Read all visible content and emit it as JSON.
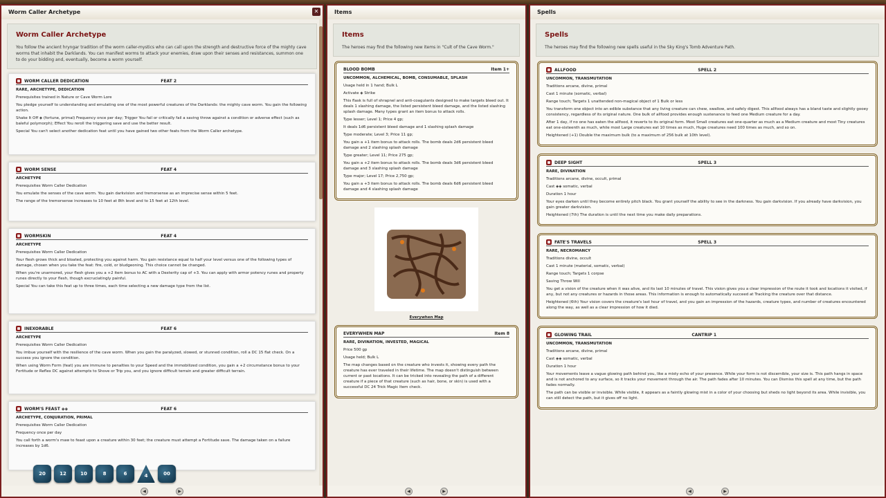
{
  "windows": {
    "worm": {
      "title": "Worm Caller Archetype",
      "header": {
        "title": "Worm Caller Archetype",
        "text": "You follow the ancient hryngar tradition of the worm caller-mystics who can call upon the strength and destructive force of the mighty cave worms that inhabit the Darklands. You can manifest worms to attack your enemies, draw upon their senses and resistances, summon one to do your bidding and, eventually, become a worm yourself."
      },
      "cards": [
        {
          "name": "WORM CALLER DEDICATION",
          "level": "FEAT 2",
          "traits": "RARE, ARCHETYPE, DEDICATION",
          "lines": [
            "Prerequisites trained in Nature or Cave Worm Lore",
            "You pledge yourself to understanding and emulating one of the most powerful creatures of the Darklands: the mighty cave worm. You gain the following action.",
            "Shake It Off ◈ (fortune, primal) Frequency once per day; Trigger You fail or critically fail a saving throw against a condition or adverse effect (such as baleful polymorph); Effect You reroll the triggering save and use the better result.",
            "Special You can't select another dedication feat until you have gained two other feats from the Worm Caller archetype."
          ]
        },
        {
          "name": "WORM SENSE",
          "level": "FEAT 4",
          "traits": "ARCHETYPE",
          "lines": [
            "Prerequisites Worm Caller Dedication",
            "You emulate the senses of the cave worm. You gain darkvision and tremorsense as an imprecise sense within 5 feet.",
            "The range of the tremorsense increases to 10 feet at 8th level and to 15 feet at 12th level."
          ]
        },
        {
          "name": "WORMSKIN",
          "level": "FEAT 4",
          "traits": "ARCHETYPE",
          "lines": [
            "Prerequisites Worm Caller Dedication",
            "Your flesh grows thick and bloated, protecting you against harm. You gain resistance equal to half your level versus one of the following types of damage, chosen when you take the feat: fire, cold, or bludgeoning. This choice cannot be changed.",
            "When you're unarmored, your flesh gives you a +2 item bonus to AC with a Dexterity cap of +3. You can apply with armor potency runes and property runes directly to your flesh, though excruciatingly painful.",
            "Special You can take this feat up to three times, each time selecting a new damage type from the list."
          ]
        },
        {
          "name": "INEXORABLE",
          "level": "FEAT 6",
          "traits": "ARCHETYPE",
          "lines": [
            "Prerequisites Worm Caller Dedication",
            "You imbue yourself with the resilience of the cave worm. When you gain the paralyzed, slowed, or stunned condition, roll a DC 15 flat check. On a success you ignore the condition.",
            "When using Worm Form (feat) you are immune to penalties to your Speed and the immobilized condition, you gain a +2 circumstance bonus to your Fortitude or Reflex DC against attempts to Shove or Trip you, and you ignore difficult terrain and greater difficult terrain."
          ]
        },
        {
          "name": "WORM'S FEAST ◈◈",
          "level": "FEAT 6",
          "traits": "ARCHETYPE, CONJURATION, PRIMAL",
          "lines": [
            "Prerequisites Worm Caller Dedication",
            "Frequency once per day",
            "You call forth a worm's maw to feast upon a creature within 30 feet; the creature must attempt a Fortitude save. The damage taken on a failure increases by 1d6."
          ]
        }
      ],
      "dice": [
        "20",
        "12",
        "10",
        "8",
        "6",
        "4",
        "00"
      ]
    },
    "items": {
      "title": "Items",
      "header": {
        "title": "Items",
        "text": "The heroes may find the following new items in \"Cult of the Cave Worm.\""
      },
      "cards": [
        {
          "name": "BLOOD BOMB",
          "level": "Item 1+",
          "traits": "UNCOMMON, ALCHEMICAL, BOMB, CONSUMABLE, SPLASH",
          "lines": [
            "Usage held in 1 hand; Bulk L",
            "Activate ◈ Strike",
            "This flask is full of shrapnel and anti-coagulants designed to make targets bleed out. It deals 1 slashing damage, the listed persistent bleed damage, and the listed slashing splash damage. Many types grant an item bonus to attack rolls.",
            "Type lesser; Level 1; Price 4 gp;",
            "It deals 1d6 persistent bleed damage and 1 slashing splash damage",
            "Type moderate; Level 3; Price 11 gp;",
            "You gain a +1 item bonus to attack rolls. The bomb deals 2d6 persistent bleed damage and 2 slashing splash damage",
            "Type greater; Level 11; Price 275 gp;",
            "You gain a +2 item bonus to attack rolls. The bomb deals 3d6 persistent bleed damage and 3 slashing splash damage",
            "Type major; Level 17; Price 2,750 gp;",
            "You gain a +3 item bonus to attack rolls. The bomb deals 6d6 persistent bleed damage and 4 slashing splash damage"
          ]
        },
        {
          "name": "EVERYWHEN MAP",
          "level": "Item 8",
          "traits": "RARE, DIVINATION, INVESTED, MAGICAL",
          "lines": [
            "Price 500 gp",
            "Usage held; Bulk L",
            "The map changes based on the creature who invests it, showing every path the creature has ever traveled in their lifetime. The map doesn't distinguish between current or past locations. It can be tricked into revealing the path of a different creature if a piece of that creature (such as hair, bone, or skin) is used with a successful DC 24 Trick Magic Item check."
          ]
        }
      ],
      "map_caption": "Everywhen Map"
    },
    "spells": {
      "title": "Spells",
      "header": {
        "title": "Spells",
        "text": "The heroes may find the following new spells useful in the Sky King's Tomb Adventure Path."
      },
      "cards": [
        {
          "name": "ALLFOOD",
          "level": "SPELL 2",
          "traits": "UNCOMMON, TRANSMUTATION",
          "lines": [
            "Traditions arcane, divine, primal",
            "Cast 1 minute (somatic, verbal)",
            "Range touch; Targets 1 unattended non-magical object of 1 Bulk or less",
            "You transform one object into an edible substance that any living creature can chew, swallow, and safely digest. This allfood always has a bland taste and slightly gooey consistency, regardless of its original nature. One bulk of allfood provides enough sustenance to feed one Medium creature for a day.",
            "After 1 day, if no one has eaten the allfood, it reverts to its original form. Most Small creatures eat one-quarter as much as a Medium creature and most Tiny creatures eat one-sixteenth as much, while most Large creatures eat 10 times as much, Huge creatures need 100 times as much, and so on.",
            "Heightened (+1) Double the maximum bulk (to a maximum of 256 bulk at 10th level)."
          ]
        },
        {
          "name": "DEEP SIGHT",
          "level": "SPELL 3",
          "traits": "RARE, DIVINATION",
          "lines": [
            "Traditions arcane, divine, occult, primal",
            "Cast ◈◈ somatic, verbal",
            "Duration 1 hour",
            "Your eyes darken until they become entirely pitch black. You grant yourself the ability to see in the darkness. You gain darkvision. If you already have darkvision, you gain greater darkvision.",
            "Heightened (7th) The duration is until the next time you make daily preparations."
          ]
        },
        {
          "name": "FATE'S TRAVELS",
          "level": "SPELL 3",
          "traits": "RARE, NECROMANCY",
          "lines": [
            "Traditions divine, occult",
            "Cast 1 minute (material, somatic, verbal)",
            "Range touch; Targets 1 corpse",
            "Saving Throw Will",
            "You get a vision of the creature when it was alive, and its last 10 minutes of travel. This vision gives you a clear impression of the route it took and locations it visited, if any, but not any creatures or hazards in those areas. This information is enough to automatically succeed at Tracking the creature over that distance.",
            "Heightened (6th) Your vision covers the creature's last hour of travel, and you gain an impression of the hazards, creature types, and number of creatures encountered along the way, as well as a clear impression of how it died."
          ]
        },
        {
          "name": "GLOWING TRAIL",
          "level": "CANTRIP 1",
          "traits": "UNCOMMON, TRANSMUTATION",
          "lines": [
            "Traditions arcane, divine, primal",
            "Cast ◈◈ somatic, verbal",
            "Duration 1 hour",
            "Your movements leave a vague glowing path behind you, like a misty echo of your presence. While your form is not discernible, your size is. This path hangs in space and is not anchored to any surface, so it tracks your movement through the air. The path fades after 10 minutes. You can Dismiss this spell at any time, but the path fades normally.",
            "The path can be visible or invisible. While visible, it appears as a faintly glowing mist in a color of your choosing but sheds no light beyond its area. While invisible, you can still detect the path, but it gives off no light."
          ]
        }
      ]
    }
  },
  "nav": {
    "prev": "◀",
    "next": "▶"
  },
  "colors": {
    "accent": "#7a1313",
    "frame": "#7a1f1f",
    "gold": "#7a5a1a"
  }
}
